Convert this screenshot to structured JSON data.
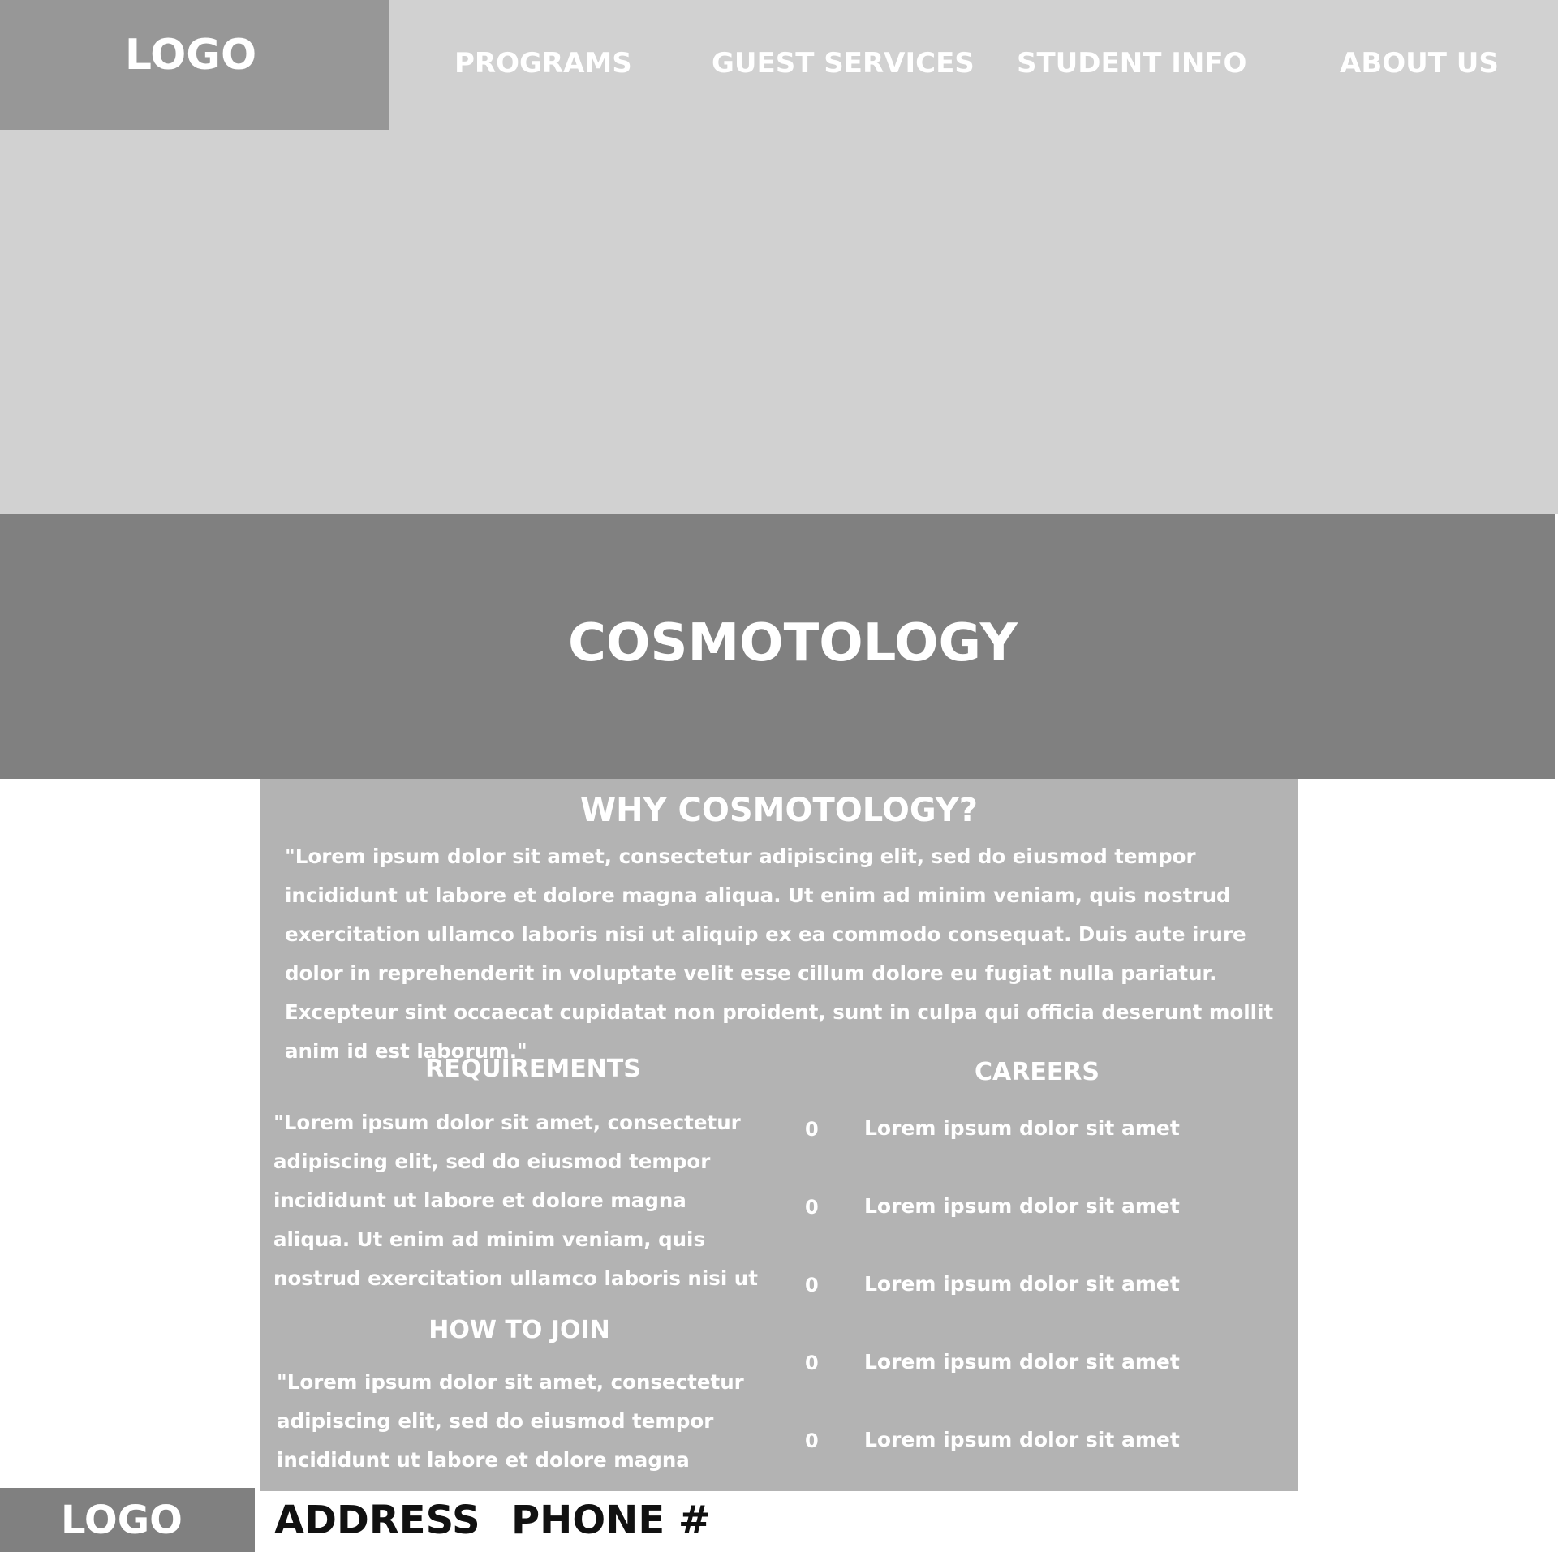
{
  "header": {
    "logo": "LOGO",
    "nav": [
      "PROGRAMS",
      "GUEST SERVICES",
      "STUDENT INFO",
      "ABOUT US"
    ]
  },
  "hero": {
    "title": "COSMOTOLOGY"
  },
  "why": {
    "heading": "WHY COSMOTOLOGY?",
    "body": "\"Lorem ipsum dolor sit amet, consectetur adipiscing elit, sed do eiusmod tempor incididunt ut labore et dolore magna aliqua. Ut enim ad minim veniam, quis nostrud exercitation ullamco laboris nisi ut aliquip ex ea commodo consequat. Duis aute irure dolor in reprehenderit in voluptate velit esse cillum dolore eu fugiat nulla pariatur. Excepteur sint occaecat cupidatat non proident, sunt in culpa qui officia deserunt mollit anim id est laborum.\""
  },
  "requirements": {
    "heading": "REQUIREMENTS",
    "body": "\"Lorem ipsum dolor sit amet, consectetur adipiscing elit, sed do eiusmod tempor incididunt ut labore et dolore magna aliqua. Ut enim ad minim veniam, quis nostrud exercitation ullamco laboris nisi ut aliquip ex ea commodo conse-"
  },
  "how_to_join": {
    "heading": "HOW TO JOIN",
    "body": "\"Lorem ipsum dolor sit amet, consectetur adipiscing elit, sed do eiusmod tempor incididunt ut labore et dolore magna aliqua. Ut enim ad"
  },
  "careers": {
    "heading": "CAREERS",
    "items": [
      {
        "bullet": "0",
        "text": "Lorem ipsum dolor sit amet"
      },
      {
        "bullet": "0",
        "text": "Lorem ipsum dolor sit amet"
      },
      {
        "bullet": "0",
        "text": "Lorem ipsum dolor sit amet"
      },
      {
        "bullet": "0",
        "text": "Lorem ipsum dolor sit amet"
      },
      {
        "bullet": "0",
        "text": "Lorem ipsum dolor sit amet"
      }
    ]
  },
  "footer": {
    "logo": "LOGO",
    "address": "ADDRESS",
    "phone": "PHONE #"
  }
}
